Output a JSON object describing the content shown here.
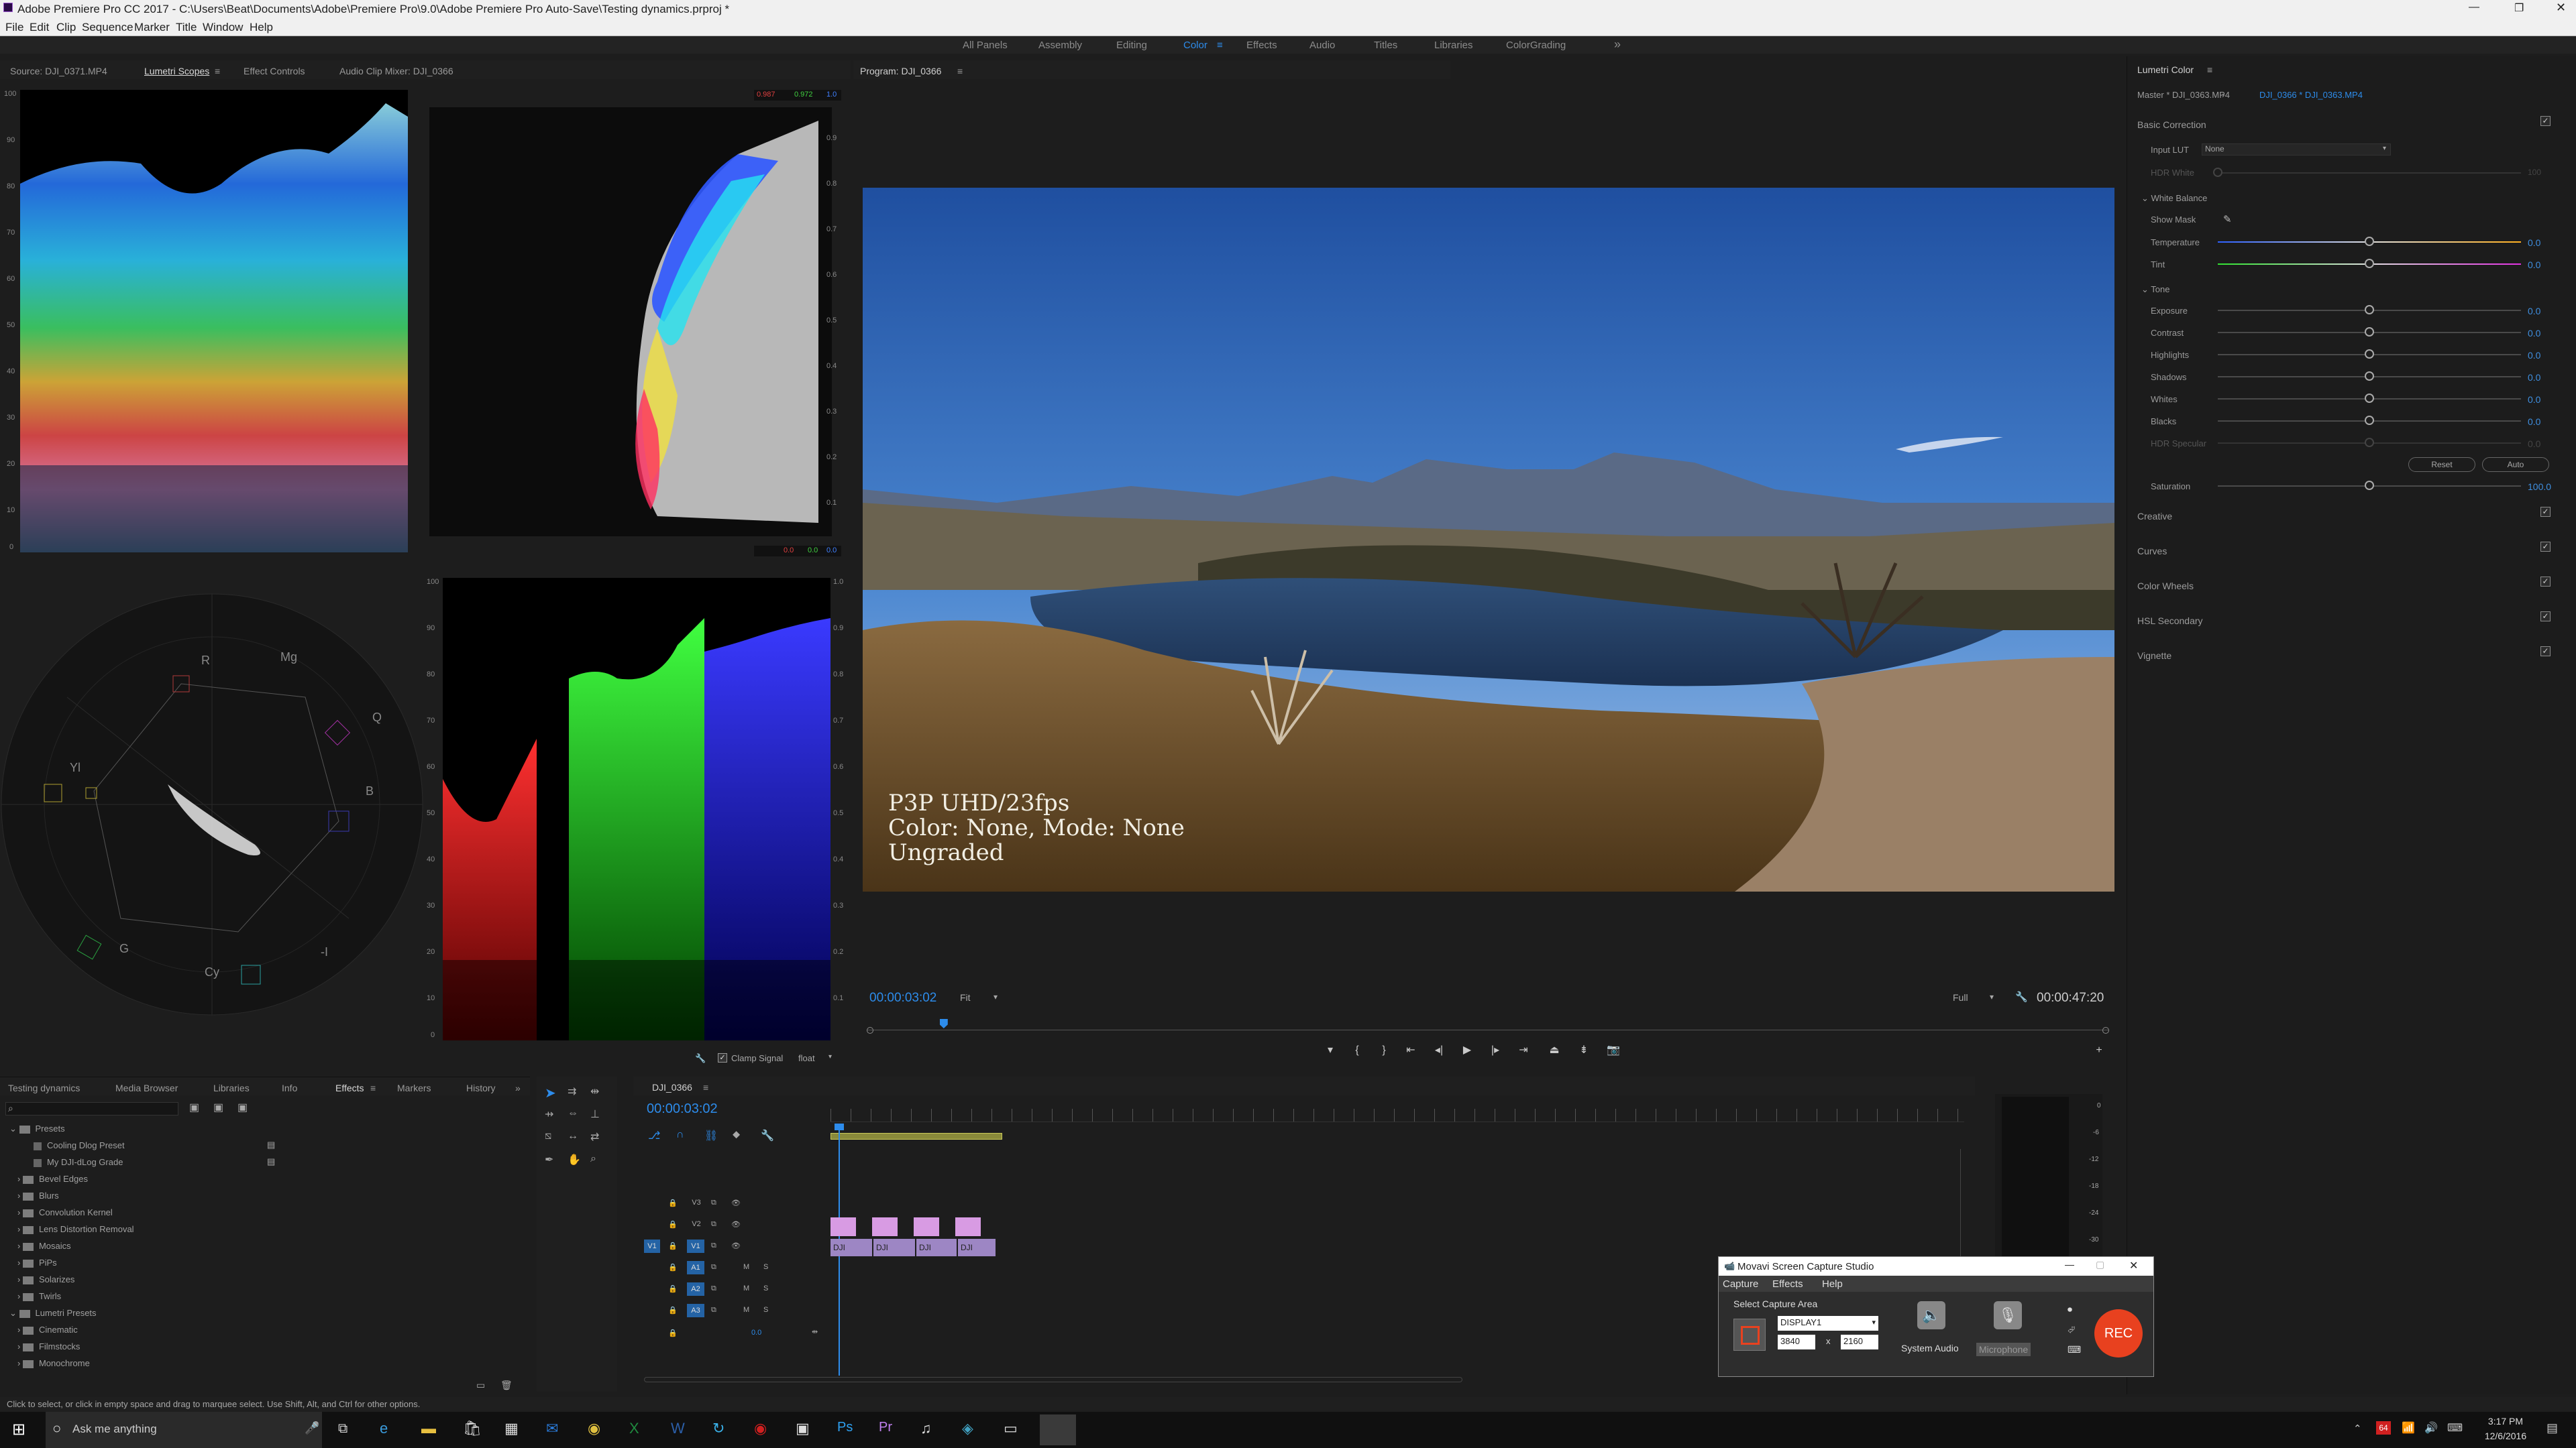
{
  "window": {
    "title": "Adobe Premiere Pro CC 2017 - C:\\Users\\Beat\\Documents\\Adobe\\Premiere Pro\\9.0\\Adobe Premiere Pro Auto-Save\\Testing dynamics.prproj *"
  },
  "menu": [
    "File",
    "Edit",
    "Clip",
    "Sequence",
    "Marker",
    "Title",
    "Window",
    "Help"
  ],
  "workspaces": {
    "items": [
      "All Panels",
      "Assembly",
      "Editing",
      "Color",
      "Effects",
      "Audio",
      "Titles",
      "Libraries",
      "ColorGrading"
    ],
    "active": "Color",
    "more": "»"
  },
  "source_panel": {
    "tabs": [
      "Source: DJI_0371.MP4",
      "Lumetri Scopes",
      "Effect Controls",
      "Audio Clip Mixer: DJI_0366"
    ],
    "active": "Lumetri Scopes"
  },
  "scopes": {
    "waveform_scale": [
      "100",
      "90",
      "80",
      "70",
      "60",
      "50",
      "40",
      "30",
      "20",
      "10",
      "0"
    ],
    "parade_scale": [
      "100",
      "90",
      "80",
      "70",
      "60",
      "50",
      "40",
      "30",
      "20",
      "10",
      "0"
    ],
    "parade_right_scale": [
      "1.0",
      "0.9",
      "0.8",
      "0.7",
      "0.6",
      "0.5",
      "0.4",
      "0.3",
      "0.2",
      "0.1",
      "0.0"
    ],
    "histo_scale": [
      "1.0",
      "0.9",
      "0.8",
      "0.7",
      "0.6",
      "0.5",
      "0.4",
      "0.3",
      "0.2",
      "0.1",
      "0.0"
    ],
    "histo_top": [
      "0.987",
      "0.972",
      "1.0"
    ],
    "histo_bottom": [
      "0.0",
      "0.0",
      "0.0"
    ],
    "vector_labels": {
      "r": "R",
      "mg": "Mg",
      "b": "B",
      "cy": "Cy",
      "g": "G",
      "yl": "Yl",
      "i": "I",
      "q": "Q",
      "neg_i": "-I"
    },
    "clamp_label": "Clamp Signal",
    "float_label": "float"
  },
  "program": {
    "title": "Program: DJI_0366",
    "overlay": [
      "P3P UHD/23fps",
      "Color: None, Mode: None",
      "Ungraded"
    ],
    "timecode": "00:00:03:02",
    "fit": "Fit",
    "quality": "Full",
    "duration": "00:00:47:20",
    "playhead_fraction": 0.062
  },
  "lumetri": {
    "title": "Lumetri Color",
    "master": "Master * DJI_0363.MP4",
    "clip": "DJI_0366 * DJI_0363.MP4",
    "basic_correction": "Basic Correction",
    "input_lut_label": "Input LUT",
    "input_lut_value": "None",
    "hdr_white": "HDR White",
    "hdr_white_val": "100",
    "white_balance": "White Balance",
    "show_mask": "Show Mask",
    "wb": [
      {
        "label": "Temperature",
        "value": "0.0",
        "fraction": 0.5
      },
      {
        "label": "Tint",
        "value": "0.0",
        "fraction": 0.5
      }
    ],
    "tone": "Tone",
    "tone_rows": [
      {
        "label": "Exposure",
        "value": "0.0",
        "fraction": 0.5
      },
      {
        "label": "Contrast",
        "value": "0.0",
        "fraction": 0.5
      },
      {
        "label": "Highlights",
        "value": "0.0",
        "fraction": 0.5
      },
      {
        "label": "Shadows",
        "value": "0.0",
        "fraction": 0.5
      },
      {
        "label": "Whites",
        "value": "0.0",
        "fraction": 0.5
      },
      {
        "label": "Blacks",
        "value": "0.0",
        "fraction": 0.5
      },
      {
        "label": "HDR Specular",
        "value": "0.0",
        "fraction": 0.5
      }
    ],
    "reset": "Reset",
    "auto": "Auto",
    "saturation": "Saturation",
    "saturation_value": "100.0",
    "saturation_fraction": 0.5,
    "sections": [
      "Creative",
      "Curves",
      "Color Wheels",
      "HSL Secondary",
      "Vignette"
    ]
  },
  "project_panel": {
    "tabs": [
      "Testing dynamics",
      "Media Browser",
      "Libraries",
      "Info",
      "Effects",
      "Markers",
      "History"
    ],
    "active": "Effects",
    "tree": [
      "Presets",
      "Cooling Dlog Preset",
      "My DJI-dLog Grade",
      "Bevel Edges",
      "Blurs",
      "Convolution Kernel",
      "Lens Distortion Removal",
      "Mosaics",
      "PiPs",
      "Solarizes",
      "Twirls",
      "Lumetri Presets",
      "Cinematic",
      "Filmstocks",
      "Monochrome"
    ]
  },
  "timeline": {
    "title": "DJI_0366",
    "timecode": "00:00:03:02",
    "tracks": [
      "V3",
      "V2",
      "V1",
      "A1",
      "A2",
      "A3"
    ],
    "source_v": "V1",
    "master_val": "0.0",
    "clips": [
      "DJI",
      "DJI",
      "DJI",
      "DJI"
    ],
    "meter_scale": [
      "0",
      "-6",
      "-12",
      "-18",
      "-24",
      "-30"
    ]
  },
  "movavi": {
    "title": "Movavi Screen Capture Studio",
    "menu": [
      "Capture",
      "Effects",
      "Help"
    ],
    "select_area": "Select Capture Area",
    "display": "DISPLAY1",
    "width": "3840",
    "x": "x",
    "height": "2160",
    "system_audio": "System Audio",
    "microphone": "Microphone",
    "rec": "REC"
  },
  "status": "Click to select, or click in empty space and drag to marquee select. Use Shift, Alt, and Ctrl for other options.",
  "taskbar": {
    "search": "Ask me anything",
    "time": "3:17 PM",
    "date": "12/6/2016",
    "badge": "64"
  },
  "colors": {
    "accent": "#2d8ceb",
    "rec": "#e8411f",
    "clip": "#d89be3"
  }
}
